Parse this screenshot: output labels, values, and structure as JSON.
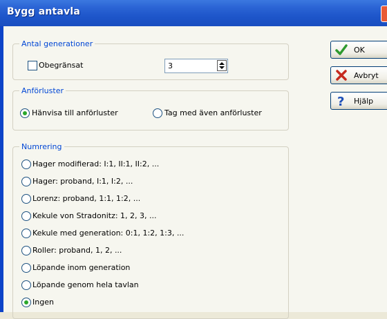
{
  "window": {
    "title": "Bygg antavla"
  },
  "generations": {
    "legend": "Antal generationer",
    "unlimited_label": "Obegränsat",
    "unlimited_checked": false,
    "count_value": "3"
  },
  "ancestor_loss": {
    "legend": "Anförluster",
    "options": [
      {
        "label": "Hänvisa till anförluster",
        "selected": true
      },
      {
        "label": "Tag med även anförluster",
        "selected": false
      }
    ]
  },
  "numbering": {
    "legend": "Numrering",
    "options": [
      {
        "label": "Hager modifierad: I:1, II:1, II:2, ...",
        "selected": false
      },
      {
        "label": "Hager: proband, I:1, I:2, ...",
        "selected": false
      },
      {
        "label": "Lorenz: proband, 1:1, 1:2, ...",
        "selected": false
      },
      {
        "label": "Kekule von Stradonitz: 1, 2, 3, ...",
        "selected": false
      },
      {
        "label": "Kekule med generation: 0:1, 1:2, 1:3, ...",
        "selected": false
      },
      {
        "label": "Roller: proband, 1, 2, ...",
        "selected": false
      },
      {
        "label": "Löpande inom generation",
        "selected": false
      },
      {
        "label": "Löpande genom hela tavlan",
        "selected": false
      },
      {
        "label": "Ingen",
        "selected": true
      }
    ]
  },
  "buttons": {
    "ok": "OK",
    "cancel": "Avbryt",
    "help": "Hjälp"
  },
  "colors": {
    "title_bar": "#1d55c9",
    "group_legend": "#0046d5",
    "radio_selected": "#2ba82b",
    "ok_icon": "#2f9a2f",
    "cancel_icon": "#c62a1f",
    "help_icon": "#1d4fb8"
  },
  "icons": {
    "ok": "checkmark-icon",
    "cancel": "x-mark-icon",
    "help": "question-mark-icon"
  }
}
